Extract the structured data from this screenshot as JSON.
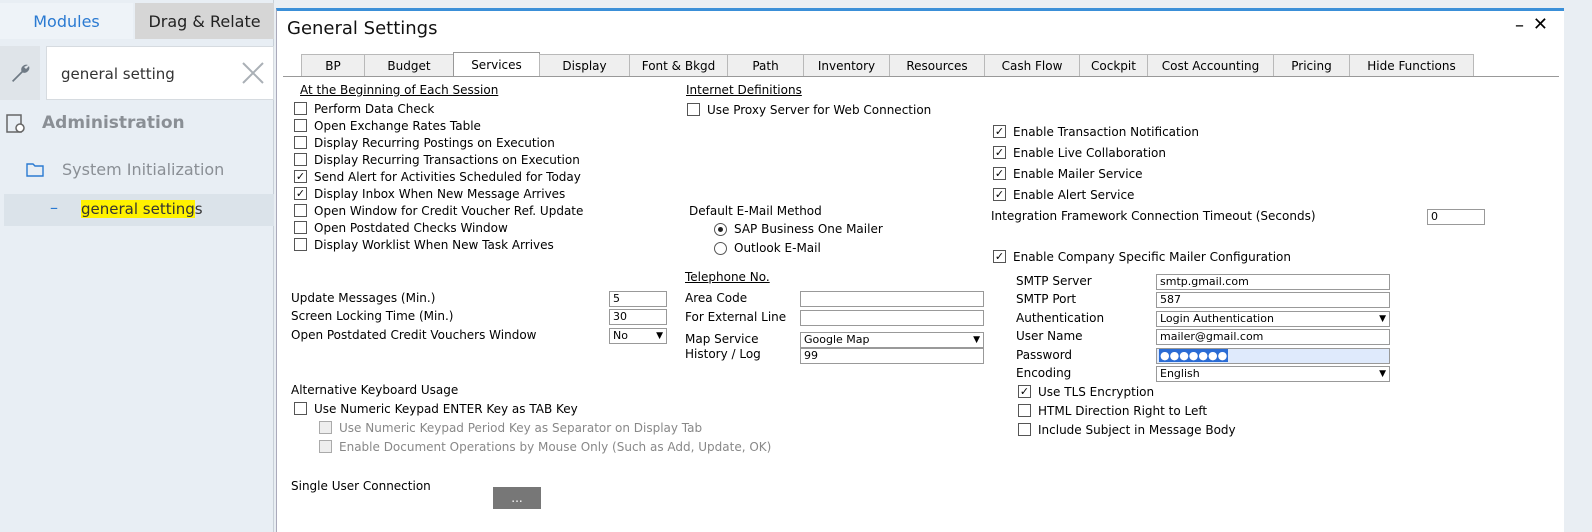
{
  "left": {
    "tab_modules": "Modules",
    "tab_drag": "Drag & Relate",
    "search_value": "general setting",
    "admin": "Administration",
    "system_init": "System Initialization",
    "gs_dash": "–",
    "gs_highlight": "general setting",
    "gs_rest": "s"
  },
  "window": {
    "title": "General Settings",
    "min": "–",
    "close": "✕"
  },
  "tabs": [
    "BP",
    "Budget",
    "Services",
    "Display",
    "Font & Bkgd",
    "Path",
    "Inventory",
    "Resources",
    "Cash Flow",
    "Cockpit",
    "Cost Accounting",
    "Pricing",
    "Hide Functions"
  ],
  "active_tab": "Services",
  "session": {
    "header": "At the Beginning of Each Session",
    "items": [
      {
        "label": "Perform Data Check",
        "checked": false
      },
      {
        "label": "Open Exchange Rates Table",
        "checked": false
      },
      {
        "label": "Display Recurring Postings on Execution",
        "checked": false
      },
      {
        "label": "Display Recurring Transactions on Execution",
        "checked": false
      },
      {
        "label": "Send Alert for Activities Scheduled for Today",
        "checked": true
      },
      {
        "label": "Display Inbox When New Message Arrives",
        "checked": true
      },
      {
        "label": "Open Window for Credit Voucher Ref. Update",
        "checked": false
      },
      {
        "label": "Open Postdated Checks Window",
        "checked": false
      },
      {
        "label": "Display Worklist When New Task Arrives",
        "checked": false
      }
    ]
  },
  "misc": {
    "update_label": "Update Messages (Min.)",
    "update_value": "5",
    "lock_label": "Screen Locking Time (Min.)",
    "lock_value": "30",
    "postdated_label": "Open Postdated Credit Vouchers Window",
    "postdated_value": "No"
  },
  "keyboard": {
    "header": "Alternative Keyboard Usage",
    "enter_tab": "Use Numeric Keypad ENTER Key as TAB Key",
    "period_sep": "Use Numeric Keypad Period Key as Separator on Display Tab",
    "mouse_only": "Enable Document Operations by Mouse Only (Such as Add, Update, OK)"
  },
  "single_user": {
    "label": "Single User Connection",
    "button": "..."
  },
  "internet": {
    "header": "Internet Definitions",
    "proxy": "Use Proxy Server for Web Connection"
  },
  "email": {
    "label": "Default E-Mail Method",
    "opt1": "SAP Business One Mailer",
    "opt2": "Outlook E-Mail"
  },
  "telephone": {
    "header": "Telephone No.",
    "area_label": "Area Code",
    "area_value": "",
    "ext_label": "For External Line",
    "ext_value": "",
    "map_label": "Map Service",
    "map_value": "Google Map",
    "history_label": "History / Log",
    "history_value": "99"
  },
  "services": {
    "transaction": "Enable Transaction Notification",
    "collab": "Enable Live Collaboration",
    "mailer": "Enable Mailer Service",
    "alert": "Enable Alert Service",
    "timeout_label": "Integration Framework Connection Timeout (Seconds)",
    "timeout_value": "0",
    "company_mailer": "Enable Company Specific Mailer Configuration"
  },
  "smtp": {
    "server_label": "SMTP Server",
    "server_value": "smtp.gmail.com",
    "port_label": "SMTP Port",
    "port_value": "587",
    "auth_label": "Authentication",
    "auth_value": "Login Authentication",
    "user_label": "User Name",
    "user_value": "mailer@gmail.com",
    "pw_label": "Password",
    "pw_value": "●●●●●●●",
    "enc_label": "Encoding",
    "enc_value": "English",
    "tls": "Use TLS Encryption",
    "rtl": "HTML Direction Right to Left",
    "subject": "Include Subject in Message Body"
  }
}
